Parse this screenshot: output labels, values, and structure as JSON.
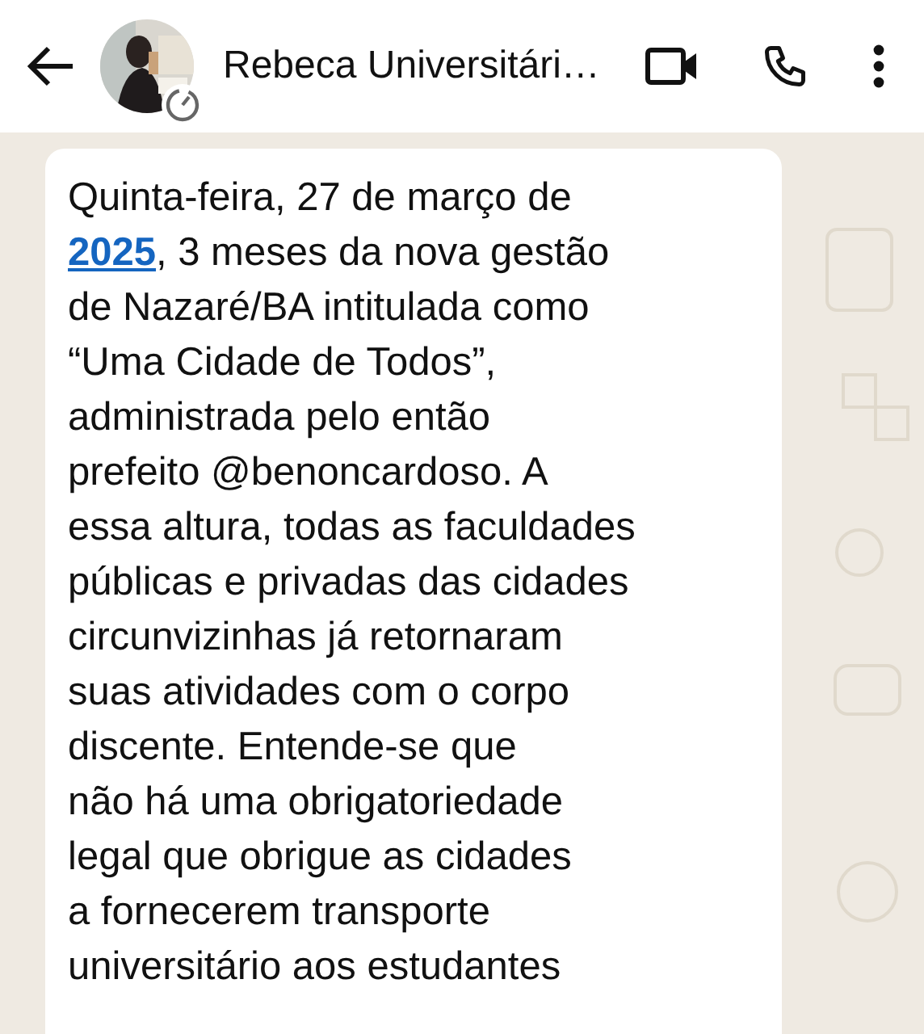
{
  "header": {
    "contact_name": "Rebeca Universitári…"
  },
  "message": {
    "before": "Quinta-feira, 27 de março de\n",
    "link": "2025",
    "after": ", 3 meses da nova gestão\nde Nazaré/BA intitulada como\n“Uma Cidade de Todos”,\nadministrada pelo então\nprefeito @benoncardoso. A\nessa altura, todas as faculdades\npúblicas e privadas das cidades\ncircunvizinhas já retornaram\nsuas atividades com o corpo\ndiscente. Entende-se que\nnão há uma obrigatoriedade\nlegal que obrigue as cidades\na fornecerem transporte\nuniversitário aos estudantes"
  }
}
